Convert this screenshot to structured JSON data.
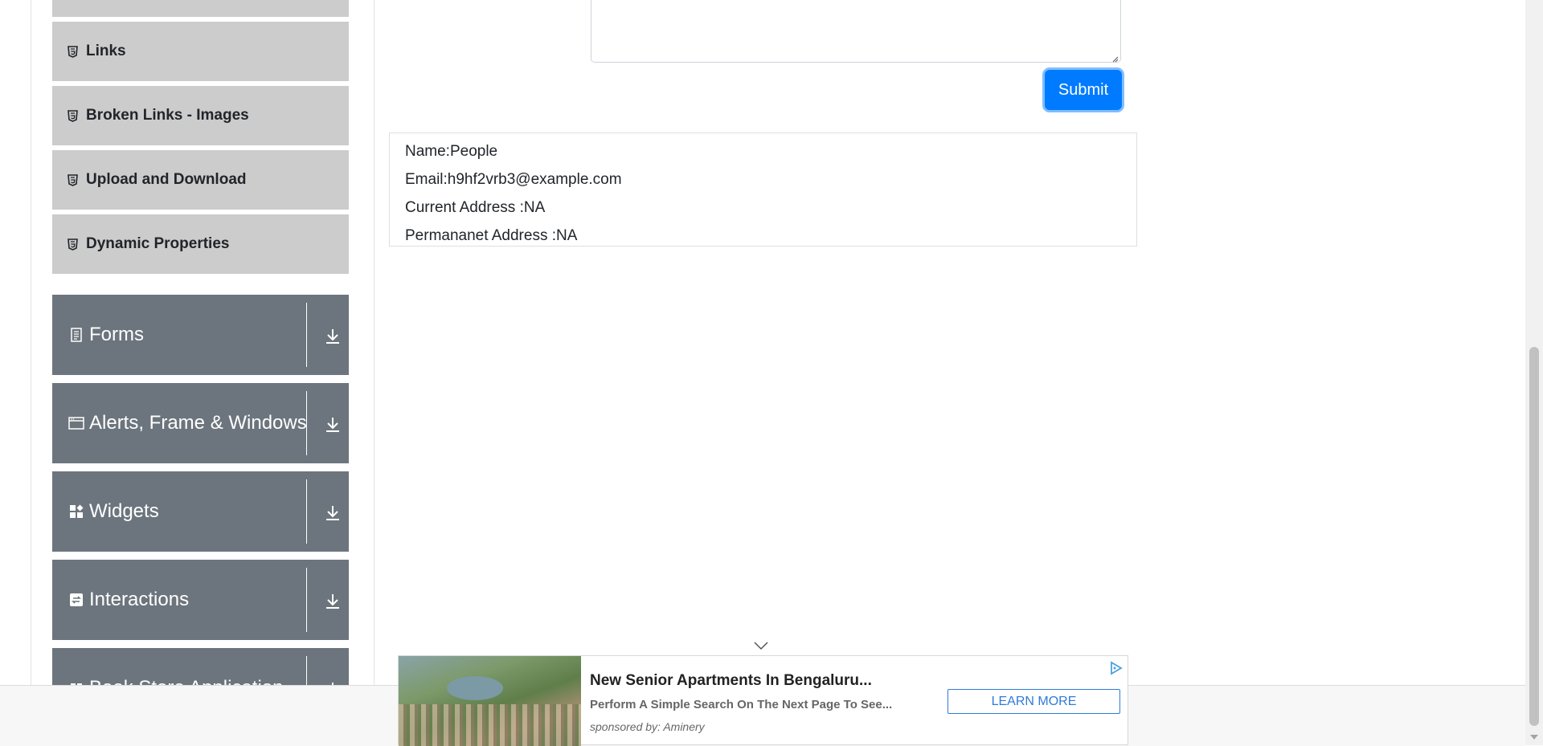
{
  "sidebar": {
    "element_items": [
      {
        "label": "",
        "icon": "html5-icon"
      },
      {
        "label": "Links",
        "icon": "html5-icon"
      },
      {
        "label": "Broken Links - Images",
        "icon": "html5-icon"
      },
      {
        "label": "Upload and Download",
        "icon": "html5-icon"
      },
      {
        "label": "Dynamic Properties",
        "icon": "html5-icon"
      }
    ],
    "groups": [
      {
        "label": "Forms",
        "icon": "form-icon"
      },
      {
        "label": "Alerts, Frame & Windows",
        "icon": "window-icon"
      },
      {
        "label": "Widgets",
        "icon": "widgets-icon"
      },
      {
        "label": "Interactions",
        "icon": "interactions-icon"
      },
      {
        "label": "Book Store Application",
        "icon": "book-icon"
      }
    ]
  },
  "form": {
    "submit_label": "Submit"
  },
  "output": {
    "name": "Name:People",
    "email": "Email:h9hf2vrb3@example.com",
    "current_address": "Current Address :NA",
    "permanent_address": "Permananet Address :NA"
  },
  "ad": {
    "title": "New Senior Apartments In Bengaluru...",
    "description": "Perform A Simple Search On The Next Page To See...",
    "sponsor": "sponsored by: Aminery",
    "cta": "LEARN MORE"
  },
  "colors": {
    "accent": "#007bff",
    "group_bg": "#6c757d",
    "item_bg": "#cccccc"
  }
}
